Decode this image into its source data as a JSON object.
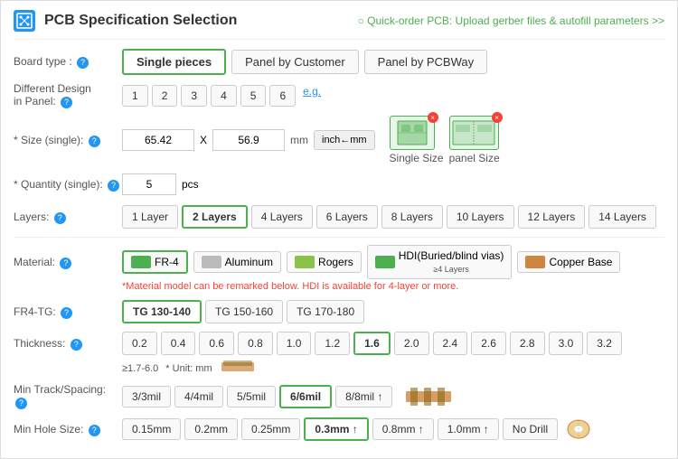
{
  "header": {
    "title": "PCB Specification Selection",
    "quick_order_text": "Quick-order PCB: Upload gerber files & autofill parameters >>"
  },
  "board_type": {
    "label": "Board type :",
    "options": [
      "Single pieces",
      "Panel by Customer",
      "Panel by PCBWay"
    ],
    "selected": "Single pieces"
  },
  "different_design": {
    "label": "Different Design in Panel :",
    "options": [
      "1",
      "2",
      "3",
      "4",
      "5",
      "6"
    ],
    "eg_label": "e.g."
  },
  "size": {
    "label": "* Size (single):",
    "value_x": "65.42",
    "value_y": "56.9",
    "unit": "mm",
    "unit_toggle": "inch←mm",
    "single_size_label": "Single Size",
    "panel_size_label": "panel Size"
  },
  "quantity": {
    "label": "* Quantity (single):",
    "value": "5",
    "unit": "pcs"
  },
  "layers": {
    "label": "Layers:",
    "options": [
      "1 Layer",
      "2 Layers",
      "4 Layers",
      "6 Layers",
      "8 Layers",
      "10 Layers",
      "12 Layers",
      "14 Layers"
    ],
    "selected": "2 Layers"
  },
  "material": {
    "label": "Material:",
    "options": [
      {
        "id": "fr4",
        "label": "FR-4",
        "color": "#4CAF50"
      },
      {
        "id": "al",
        "label": "Aluminum",
        "color": "#aaaaaa"
      },
      {
        "id": "rogers",
        "label": "Rogers",
        "color": "#8BC34A"
      },
      {
        "id": "hdi",
        "label": "HDI(Buried/blind vias)",
        "sub": "≥4 Layers",
        "color": "#4CAF50"
      },
      {
        "id": "copper",
        "label": "Copper Base",
        "color": "#CD853F"
      }
    ],
    "selected": "fr4",
    "note": "*Material model can be remarked below. HDI is available for 4-layer or more."
  },
  "fr4_tg": {
    "label": "FR4-TG:",
    "options": [
      "TG 130-140",
      "TG 150-160",
      "TG 170-180"
    ],
    "selected": "TG 130-140"
  },
  "thickness": {
    "label": "Thickness:",
    "options": [
      "0.2",
      "0.4",
      "0.6",
      "0.8",
      "1.0",
      "1.2",
      "1.6",
      "2.0",
      "2.4",
      "2.6",
      "2.8",
      "3.0",
      "3.2"
    ],
    "selected": "1.6",
    "range_note": "≥1.7-6.0",
    "unit_note": "* Unit: mm"
  },
  "min_track": {
    "label": "Min Track/Spacing:",
    "options": [
      "3/3mil",
      "4/4mil",
      "5/5mil",
      "6/6mil",
      "8/8mil ↑"
    ],
    "selected": "6/6mil"
  },
  "min_hole": {
    "label": "Min Hole Size:",
    "options": [
      "0.15mm",
      "0.2mm",
      "0.25mm",
      "0.3mm ↑",
      "0.8mm ↑",
      "1.0mm ↑",
      "No Drill"
    ],
    "selected": "0.3mm ↑"
  }
}
